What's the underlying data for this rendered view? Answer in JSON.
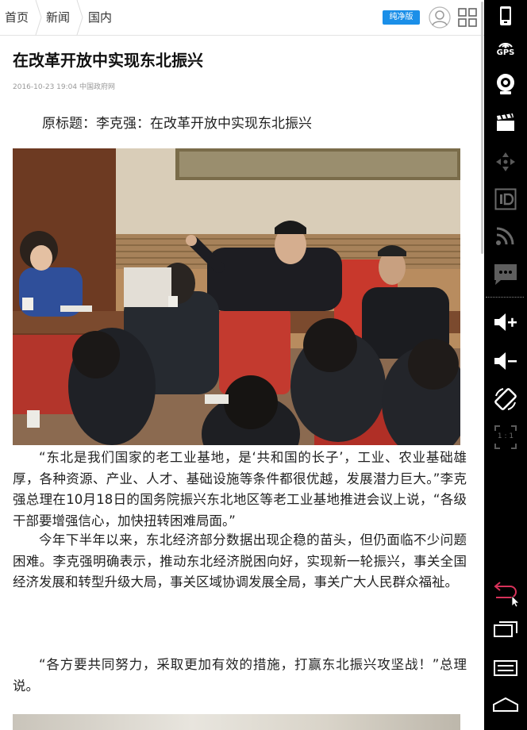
{
  "nav": {
    "crumbs": [
      "首页",
      "新闻",
      "国内"
    ],
    "pure_label": "纯净版",
    "accent": "#1b8fe8"
  },
  "article": {
    "title": "在改革开放中实现东北振兴",
    "date": "2016-10-23 19:04",
    "source": "中国政府网",
    "subtitle": "原标题：李克强：在改革开放中实现东北振兴",
    "paragraphs": [
      "“东北是我们国家的老工业基地，是‘共和国的长子’，工业、农业基础雄厚，各种资源、产业、人才、基础设施等条件都很优越，发展潜力巨大。”李克强总理在10月18日的国务院振兴东北地区等老工业基地推进会议上说，“各级干部要增强信心，加快扭转困难局面。”",
      "今年下半年以来，东北经济部分数据出现企稳的苗头，但仍面临不少问题困难。李克强明确表示，推动东北经济脱困向好，实现新一轮振兴，事关全国经济发展和转型升级大局，事关区域协调发展全局，事关广大人民群众福祉。",
      "“各方要共同努力，采取更加有效的措施，打赢东北振兴攻坚战！”总理说。"
    ]
  },
  "sidebar": {
    "gps_label": "GPS",
    "zoom_label": "1 : 1",
    "icons": [
      "phone-icon",
      "gps-icon",
      "camera-icon",
      "video-clapper-icon",
      "dpad-icon",
      "id-icon",
      "rss-icon",
      "message-icon",
      "volume-up-icon",
      "volume-down-icon",
      "rotate-icon",
      "scale-icon",
      "back-icon",
      "recent-apps-icon",
      "menu-icon",
      "home-icon"
    ]
  }
}
